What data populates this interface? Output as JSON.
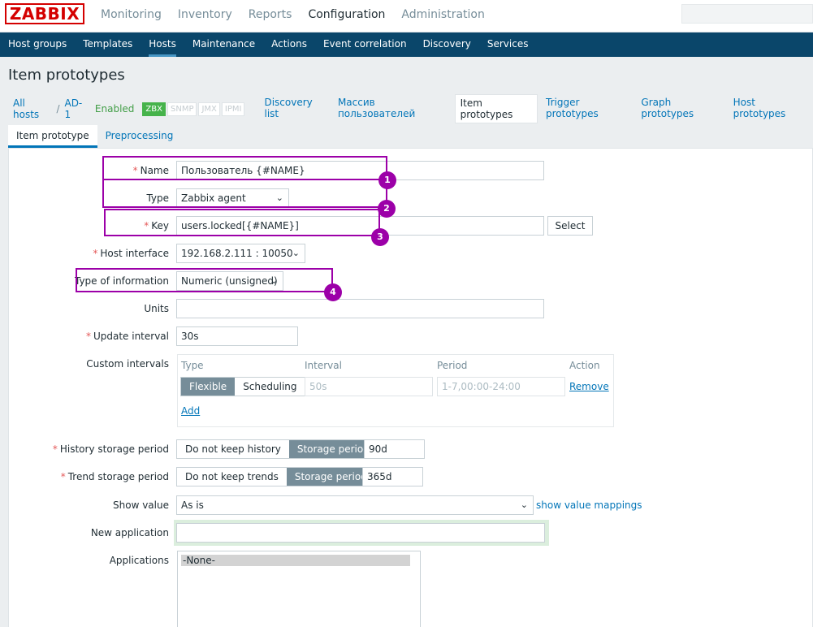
{
  "logo": "ZABBIX",
  "top_menu": [
    "Monitoring",
    "Inventory",
    "Reports",
    "Configuration",
    "Administration"
  ],
  "sub_menu": [
    "Host groups",
    "Templates",
    "Hosts",
    "Maintenance",
    "Actions",
    "Event correlation",
    "Discovery",
    "Services"
  ],
  "page_title": "Item prototypes",
  "breadcrumbs": {
    "all_hosts": "All hosts",
    "sep": "/",
    "host": "AD-1",
    "status": "Enabled",
    "badges": [
      "ZBX",
      "SNMP",
      "JMX",
      "IPMI"
    ],
    "tabs": [
      "Discovery list",
      "Массив пользователей",
      "Item prototypes",
      "Trigger prototypes",
      "Graph prototypes",
      "Host prototypes"
    ]
  },
  "form_tabs": [
    "Item prototype",
    "Preprocessing"
  ],
  "form": {
    "required_mark": "*",
    "name_label": "Name",
    "name_value": "Пользователь {#NAME}",
    "type_label": "Type",
    "type_value": "Zabbix agent",
    "key_label": "Key",
    "key_value": "users.locked[{#NAME}]",
    "select_button": "Select",
    "host_interface_label": "Host interface",
    "host_interface_value": "192.168.2.111 : 10050",
    "type_info_label": "Type of information",
    "type_info_value": "Numeric (unsigned)",
    "units_label": "Units",
    "update_interval_label": "Update interval",
    "update_interval_value": "30s",
    "custom_intervals_label": "Custom intervals",
    "ci_headers": [
      "Type",
      "Interval",
      "Period",
      "Action"
    ],
    "ci_flexible": "Flexible",
    "ci_scheduling": "Scheduling",
    "ci_interval_placeholder": "50s",
    "ci_period_placeholder": "1-7,00:00-24:00",
    "ci_remove": "Remove",
    "ci_add": "Add",
    "history_label": "History storage period",
    "history_opt_no": "Do not keep history",
    "history_opt_yes": "Storage period",
    "history_value": "90d",
    "trend_label": "Trend storage period",
    "trend_opt_no": "Do not keep trends",
    "trend_opt_yes": "Storage period",
    "trend_value": "365d",
    "show_value_label": "Show value",
    "show_value_value": "As is",
    "show_value_mappings": "show value mappings",
    "new_app_label": "New application",
    "applications_label": "Applications",
    "applications_item": "-None-"
  },
  "annotations": [
    "1",
    "2",
    "3",
    "4"
  ],
  "colors": {
    "accent": "#0275b8",
    "subnav": "#0a466a",
    "annotation": "#9c00a8",
    "enabled": "#429e47"
  }
}
